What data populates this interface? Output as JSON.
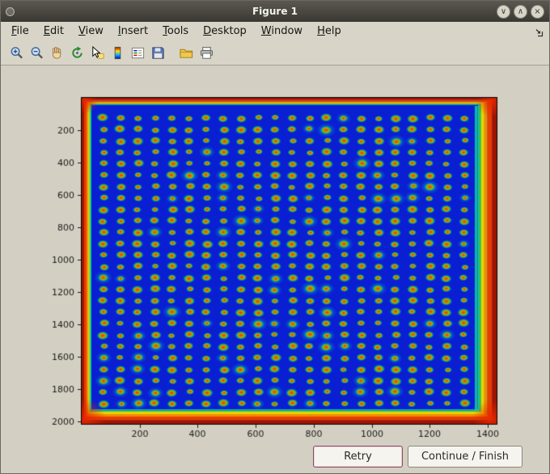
{
  "window": {
    "title": "Figure 1",
    "controls": {
      "minimize": "∨",
      "maximize": "∧",
      "close": "×"
    }
  },
  "menubar": {
    "items": [
      "File",
      "Edit",
      "View",
      "Insert",
      "Tools",
      "Desktop",
      "Window",
      "Help"
    ]
  },
  "toolbar": {
    "tools": [
      "zoom-in",
      "zoom-out",
      "pan",
      "rotate-3d",
      "data-cursor",
      "insert-colorbar",
      "insert-legend",
      "save-figure",
      "open-file",
      "print-figure"
    ]
  },
  "buttons": {
    "retry": "Retry",
    "continue_finish": "Continue / Finish"
  },
  "colors": {
    "window_chrome": "#d8d5c8",
    "titlebar_start": "#5a5850",
    "titlebar_end": "#3a3832",
    "titlebar_text": "#f2f1ea",
    "figure_background": "#d3d0c3",
    "button_face": "#f5f4ef",
    "button_text": "#2a2a26",
    "retry_border": "#8a4a62",
    "continue_border": "#8a887a"
  },
  "chart_data": {
    "type": "heatmap",
    "title": "",
    "xlabel": "",
    "ylabel": "",
    "description": "Plate / microarray scan displayed with jet colormap: deep blue field, regular 22x26 grid of red spots with yellow-green halos, saturated red-orange hot bands along all four image edges and a cyan-green vertical strip just inside the right edge; y axis increases downward",
    "x_range": [
      0,
      1430
    ],
    "y_range": [
      0,
      2015
    ],
    "xticks": [
      200,
      400,
      600,
      800,
      1000,
      1200,
      1400
    ],
    "yticks": [
      200,
      400,
      600,
      800,
      1000,
      1200,
      1400,
      1600,
      1800,
      2000
    ],
    "spot_grid": {
      "rows": 26,
      "cols": 22
    },
    "colormap": "jet",
    "grid": "off",
    "legend": "none",
    "colors": {
      "field_blue": "#0a1ed2",
      "spot_core": "#e03000",
      "spot_mid": "#cc9a00",
      "spot_halo": "#2abe3c",
      "edge_dark_red": "#a01400",
      "edge_red": "#e83c00",
      "edge_orange": "#f08c00",
      "edge_yellow": "#e8d400",
      "edge_green": "#50c832",
      "edge_cyan": "#00c8b4",
      "tick_text": "#1a1a1a"
    }
  }
}
